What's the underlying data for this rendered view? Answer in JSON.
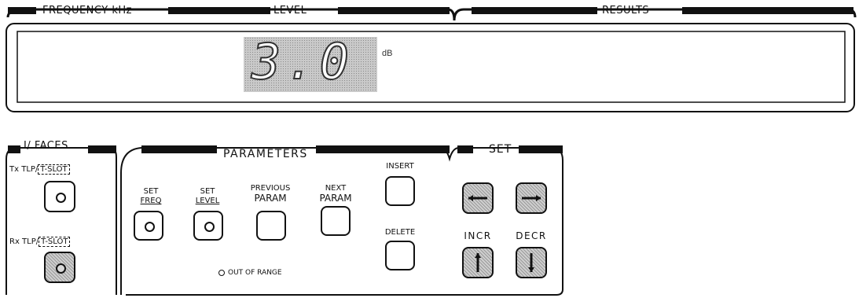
{
  "display_panel": {
    "frequency_label": "FREQUENCY kHz",
    "level_label": "LEVEL",
    "results_label": "RESULTS",
    "readout_value": "3.0",
    "readout_unit": "dB"
  },
  "interfaces": {
    "header": "I/ FACES",
    "tx_label": "Tx TLP/",
    "tx_slot": "T-SLOT",
    "rx_label": "Rx TLP/",
    "rx_slot": "T-SLOT"
  },
  "parameters": {
    "header": "PARAMETERS",
    "set_freq_top": "SET",
    "set_freq_bottom": "FREQ",
    "set_level_top": "SET",
    "set_level_bottom": "LEVEL",
    "previous_param_top": "PREVIOUS",
    "previous_param_bottom": "PARAM",
    "next_param_top": "NEXT",
    "next_param_bottom": "PARAM",
    "insert_label": "INSERT",
    "delete_label": "DELETE",
    "out_of_range": "OUT OF RANGE"
  },
  "set": {
    "header": "SET",
    "incr_label": "INCR",
    "decr_label": "DECR"
  },
  "icons": {
    "left": "arrow-left-icon",
    "right": "arrow-right-icon",
    "up": "arrow-up-icon",
    "down": "arrow-down-icon"
  }
}
